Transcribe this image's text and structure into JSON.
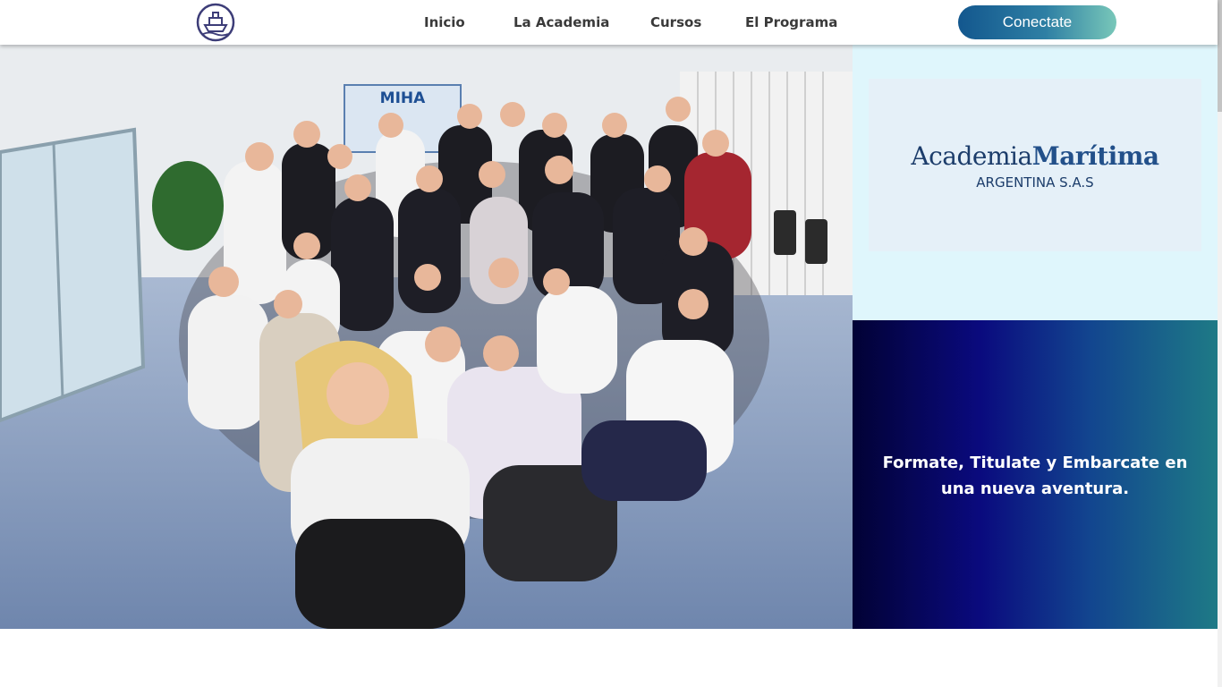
{
  "header": {
    "logo_icon": "ship-icon",
    "nav": [
      {
        "label": "Inicio"
      },
      {
        "label": "La Academia"
      },
      {
        "label": "Cursos"
      },
      {
        "label": "El Programa"
      }
    ],
    "cta_label": "Conectate",
    "cta_colors": [
      "#13578e",
      "#78c7b9"
    ]
  },
  "hero": {
    "photo_icon": "group-photo-image",
    "banner_text": "MIHA"
  },
  "brand": {
    "name_part1": "Academia",
    "name_part2": "Marítima",
    "subtitle": "ARGENTINA S.A.S"
  },
  "promo": {
    "tagline": "Formate, Titulate y Embarcate en una nueva aventura."
  },
  "colors": {
    "brand_navy": "#1c3d6b",
    "promo_gradient_start": "#020235",
    "promo_gradient_end": "#1e7a86"
  }
}
